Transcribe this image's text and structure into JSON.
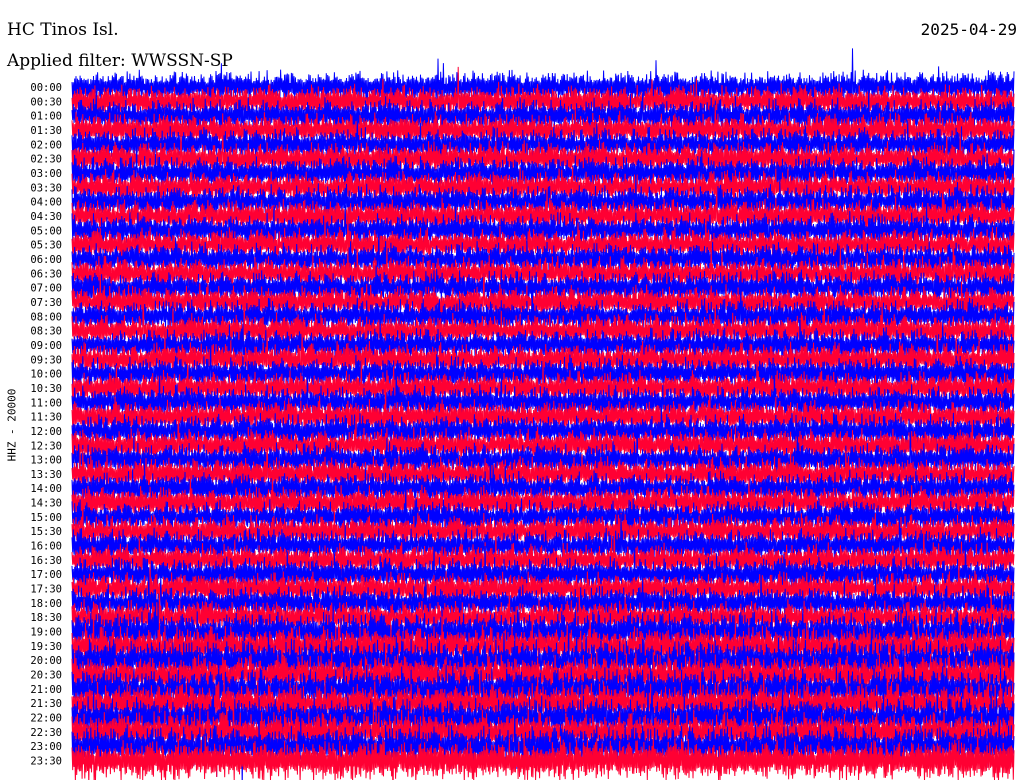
{
  "header": {
    "station": "HC Tinos Isl.",
    "date": "2025-04-29",
    "filter": "Applied filter: WWSSN-SP"
  },
  "chart_data": {
    "type": "line",
    "title": "HC Tinos Isl.",
    "subtitle": "Applied filter: WWSSN-SP",
    "ylabel": "HHZ - 20000",
    "xlabel": "",
    "date": "2025-04-29",
    "row_labels": [
      "00:00",
      "00:30",
      "01:00",
      "01:30",
      "02:00",
      "02:30",
      "03:00",
      "03:30",
      "04:00",
      "04:30",
      "05:00",
      "05:30",
      "06:00",
      "06:30",
      "07:00",
      "07:30",
      "08:00",
      "08:30",
      "09:00",
      "09:30",
      "10:00",
      "10:30",
      "11:00",
      "11:30",
      "12:00",
      "12:30",
      "13:00",
      "13:30",
      "14:00",
      "14:30",
      "15:00",
      "15:30",
      "16:00",
      "16:30",
      "17:00",
      "17:30",
      "18:00",
      "18:30",
      "19:00",
      "19:30",
      "20:00",
      "20:30",
      "21:00",
      "21:30",
      "22:00",
      "22:30",
      "23:00",
      "23:30"
    ],
    "trace_colors": [
      "#0000ff",
      "#ff0033"
    ],
    "grid": false
  }
}
